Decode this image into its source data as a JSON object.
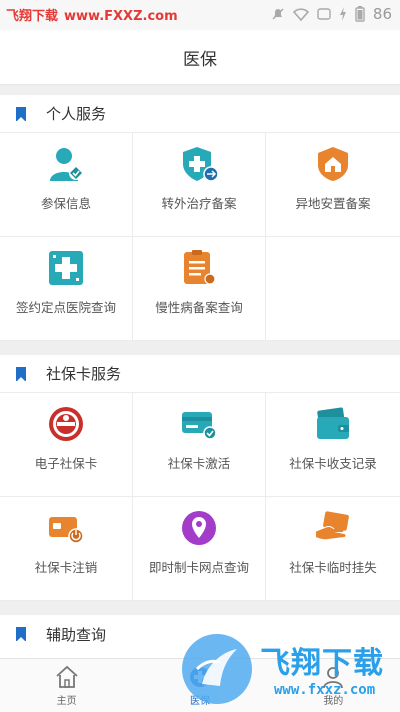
{
  "status_bar": {
    "watermark_text": "飞翔下载",
    "watermark_url": "www.FXXZ.com",
    "battery": "86"
  },
  "header": {
    "title": "医保"
  },
  "sections": [
    {
      "title": "个人服务",
      "items": [
        {
          "label": "参保信息",
          "icon": "person-check-icon"
        },
        {
          "label": "转外治疗备案",
          "icon": "medical-shield-icon"
        },
        {
          "label": "异地安置备案",
          "icon": "house-shield-icon"
        },
        {
          "label": "签约定点医院查询",
          "icon": "hospital-cross-icon"
        },
        {
          "label": "慢性病备案查询",
          "icon": "clipboard-icon"
        }
      ]
    },
    {
      "title": "社保卡服务",
      "items": [
        {
          "label": "电子社保卡",
          "icon": "social-security-emblem-icon"
        },
        {
          "label": "社保卡激活",
          "icon": "card-check-icon"
        },
        {
          "label": "社保卡收支记录",
          "icon": "wallet-card-icon"
        },
        {
          "label": "社保卡注销",
          "icon": "card-power-icon"
        },
        {
          "label": "即时制卡网点查询",
          "icon": "location-pin-icon"
        },
        {
          "label": "社保卡临时挂失",
          "icon": "hand-card-icon"
        }
      ]
    },
    {
      "title": "辅助查询"
    }
  ],
  "tabs": [
    {
      "label": "主页",
      "icon": "home-icon",
      "active": false
    },
    {
      "label": "医保",
      "icon": "medical-icon",
      "active": true
    },
    {
      "label": "我的",
      "icon": "user-icon",
      "active": false
    }
  ],
  "watermark_bottom": {
    "brand": "飞翔下载",
    "url": "www.fxxz.com"
  },
  "colors": {
    "accent": "#1f6fc6",
    "teal": "#27a9b8",
    "orange": "#e8832e",
    "purple": "#a33cc9"
  }
}
